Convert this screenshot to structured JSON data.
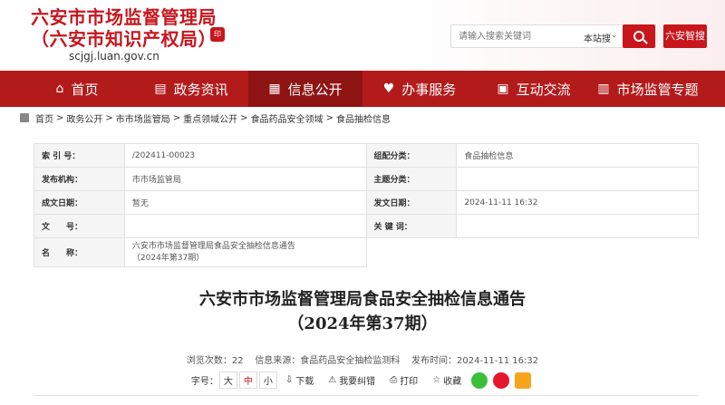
{
  "header": {
    "title_line1": "六安市市场监督管理局",
    "title_line2": "（六安市知识产权局）",
    "domain": "scjgj.luan.gov.cn"
  },
  "search": {
    "placeholder": "请输入搜索关键词",
    "scope": "本站搜",
    "smart": "六安智搜"
  },
  "nav": {
    "items": [
      {
        "label": "首页",
        "icon": "home-icon"
      },
      {
        "label": "政务资讯",
        "icon": "news-icon"
      },
      {
        "label": "信息公开",
        "icon": "open-info-icon"
      },
      {
        "label": "办事服务",
        "icon": "heart-icon"
      },
      {
        "label": "互动交流",
        "icon": "chat-icon"
      },
      {
        "label": "市场监管专题",
        "icon": "topic-icon"
      }
    ]
  },
  "breadcrumb": [
    "首页",
    "政务公开",
    "市市场监管局",
    "重点领域公开",
    "食品药品安全领域",
    "食品抽检信息"
  ],
  "meta_table": {
    "rows": [
      {
        "k1": "索 引 号：",
        "v1": "/202411-00023",
        "k2": "组配分类：",
        "v2": "食品抽检信息"
      },
      {
        "k1": "发布机构：",
        "v1": "市市场监管局",
        "k2": "主题分类：",
        "v2": ""
      },
      {
        "k1": "成文日期：",
        "v1": "暂无",
        "k2": "发文日期：",
        "v2": "2024-11-11 16:32"
      },
      {
        "k1": "文　　号：",
        "v1": "",
        "k2": "关 键 词：",
        "v2": ""
      }
    ],
    "name_key": "名　　称：",
    "name_value_1": "六安市市场监督管理局食品安全抽检信息通告",
    "name_value_2": "（2024年第37期）"
  },
  "article": {
    "title1": "六安市市场监督管理局食品安全抽检信息通告",
    "title2": "（2024年第37期）"
  },
  "article_meta": {
    "views": "浏览次数：22",
    "source": "信息来源：食品药品安全抽检监测科",
    "time": "发布时间：2024-11-11 16:32"
  },
  "tools": {
    "font_label": "字号：",
    "big": "大",
    "mid": "中",
    "small": "小",
    "download": "下载",
    "error": "我要纠错",
    "print": "打印",
    "favorite": "收藏"
  },
  "colors": {
    "brand": "#c8161d",
    "nav": "#b31b1b",
    "wechat": "#3bbf3b",
    "weibo": "#e6162d",
    "qzone": "#f6a61e"
  }
}
